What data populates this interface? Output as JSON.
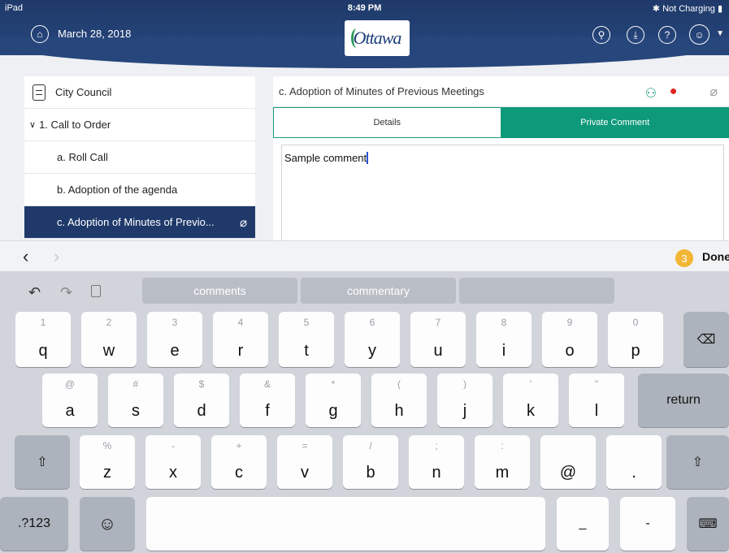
{
  "status_bar": {
    "device": "iPad",
    "time": "8:49 PM",
    "battery": "Not Charging"
  },
  "header": {
    "date": "March 28, 2018",
    "logo_text": "Ottawa"
  },
  "icons": {
    "home": "home-icon",
    "pin": "pin-icon",
    "download": "download-icon",
    "help": "help-icon",
    "user": "user-icon"
  },
  "sidebar": {
    "title": "City Council",
    "items": [
      {
        "label": "1. Call to Order",
        "caret": "∨"
      },
      {
        "label": "a. Roll Call"
      },
      {
        "label": "b. Adoption of the agenda"
      },
      {
        "label": "c. Adoption of Minutes of Previo...",
        "selected": true
      }
    ]
  },
  "detail": {
    "title": "c. Adoption of Minutes of Previous Meetings",
    "tabs": [
      {
        "label": "Details"
      },
      {
        "label": "Private Comment",
        "active": true
      }
    ],
    "comment_text": "Sample comment"
  },
  "accessory_bar": {
    "badge": "3",
    "done_label": "Done"
  },
  "keyboard": {
    "suggestions": [
      "comments",
      "commentary",
      ""
    ],
    "row1": [
      {
        "alt": "1",
        "key": "q"
      },
      {
        "alt": "2",
        "key": "w"
      },
      {
        "alt": "3",
        "key": "e"
      },
      {
        "alt": "4",
        "key": "r"
      },
      {
        "alt": "5",
        "key": "t"
      },
      {
        "alt": "6",
        "key": "y"
      },
      {
        "alt": "7",
        "key": "u"
      },
      {
        "alt": "8",
        "key": "i"
      },
      {
        "alt": "9",
        "key": "o"
      },
      {
        "alt": "0",
        "key": "p"
      }
    ],
    "row2": [
      {
        "alt": "@",
        "key": "a"
      },
      {
        "alt": "#",
        "key": "s"
      },
      {
        "alt": "$",
        "key": "d"
      },
      {
        "alt": "&",
        "key": "f"
      },
      {
        "alt": "*",
        "key": "g"
      },
      {
        "alt": "(",
        "key": "h"
      },
      {
        "alt": ")",
        "key": "j"
      },
      {
        "alt": "'",
        "key": "k"
      },
      {
        "alt": "\"",
        "key": "l"
      }
    ],
    "row3": [
      {
        "alt": "%",
        "key": "z"
      },
      {
        "alt": "-",
        "key": "x"
      },
      {
        "alt": "+",
        "key": "c"
      },
      {
        "alt": "=",
        "key": "v"
      },
      {
        "alt": "/",
        "key": "b"
      },
      {
        "alt": ";",
        "key": "n"
      },
      {
        "alt": ":",
        "key": "m"
      },
      {
        "alt": "",
        "key": "@"
      },
      {
        "alt": "",
        "key": "."
      }
    ],
    "return_label": "return",
    "numbers_label": ".?123",
    "underscore_label": "_",
    "dash_label": "-"
  }
}
